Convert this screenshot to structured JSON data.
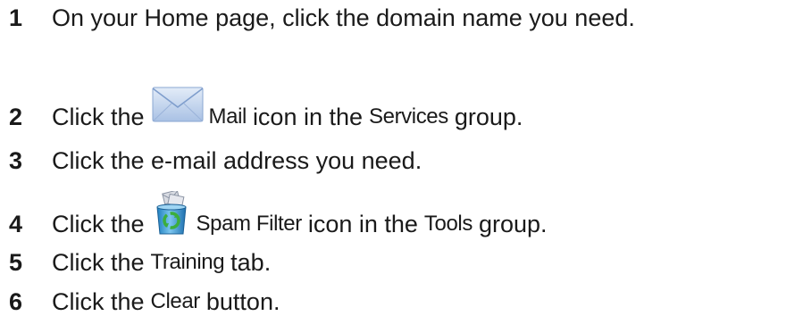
{
  "steps": [
    {
      "num": "1",
      "text": "On your Home page, click the domain name you need."
    },
    {
      "num": "2",
      "pre": "Click the",
      "ui": "Mail",
      "post": "icon in the",
      "ui2": "Services",
      "post2": "group."
    },
    {
      "num": "3",
      "text": "Click the e-mail address you need."
    },
    {
      "num": "4",
      "pre": "Click the",
      "ui": "Spam Filter",
      "post": "icon in the",
      "ui2": "Tools",
      "post2": "group."
    },
    {
      "num": "5",
      "pre": "Click the",
      "ui": "Training",
      "post": "tab."
    },
    {
      "num": "6",
      "pre": "Click the",
      "ui": "Clear",
      "post": "button."
    }
  ],
  "icons": {
    "step2": "mail-icon",
    "step4": "spam-filter-icon"
  },
  "colors": {
    "text": "#1a1a1a",
    "mail_envelope": "#b9cdea",
    "spam_bin": "#3d9fd6",
    "spam_arrows": "#3cae3c"
  }
}
